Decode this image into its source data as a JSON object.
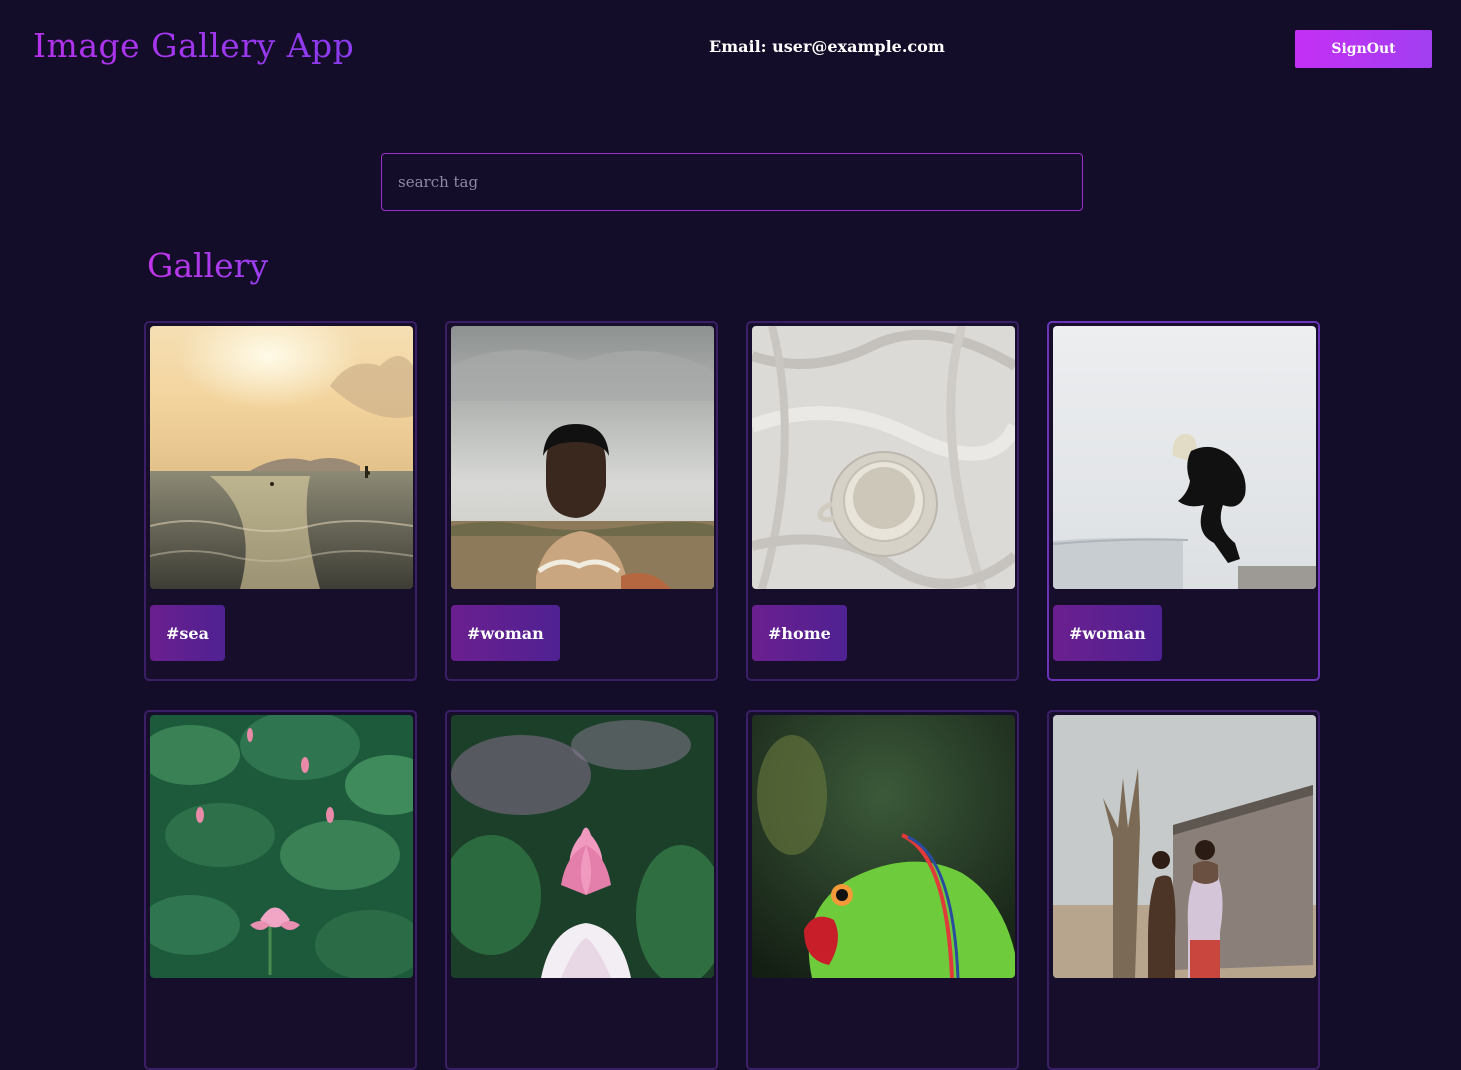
{
  "header": {
    "app_title": "Image Gallery App",
    "email_text": "Email: user@example.com",
    "signout_label": "SignOut"
  },
  "search": {
    "placeholder": "search tag",
    "value": ""
  },
  "gallery": {
    "title": "Gallery",
    "cards": [
      {
        "tag": "#sea"
      },
      {
        "tag": "#woman"
      },
      {
        "tag": "#home"
      },
      {
        "tag": "#woman"
      },
      {
        "tag": ""
      },
      {
        "tag": ""
      },
      {
        "tag": ""
      },
      {
        "tag": ""
      }
    ]
  },
  "colors": {
    "background": "#140d29",
    "accent": "#b532ec",
    "accent_secondary": "#8b3bf0",
    "card_border": "#3a1f66",
    "tag_background": "#5a2090"
  }
}
